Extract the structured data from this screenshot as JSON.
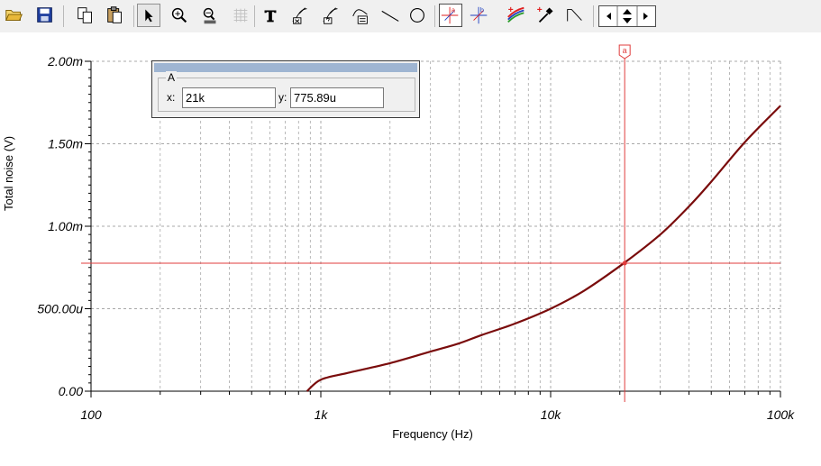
{
  "toolbar": {
    "tools": [
      {
        "icon": "open-folder-icon"
      },
      {
        "icon": "save-disk-icon"
      },
      {
        "icon": "copy-icon"
      },
      {
        "icon": "paste-icon"
      },
      {
        "icon": "pointer-arrow-icon",
        "state": "pressed"
      },
      {
        "icon": "zoom-in-icon"
      },
      {
        "icon": "zoom-100-icon"
      },
      {
        "icon": "grid-icon"
      },
      {
        "icon": "text-tool-icon"
      },
      {
        "icon": "curve-label-x-icon"
      },
      {
        "icon": "curve-label-question-icon"
      },
      {
        "icon": "curve-table-icon"
      },
      {
        "icon": "line-tool-icon"
      },
      {
        "icon": "ellipse-tool-icon"
      },
      {
        "icon": "cursor-a-icon",
        "state": "boxed"
      },
      {
        "icon": "cursor-b-icon"
      },
      {
        "icon": "add-curve-icon"
      },
      {
        "icon": "color-picker-icon"
      },
      {
        "icon": "step-line-icon"
      }
    ],
    "spinner": [
      "left-arrow-icon",
      "up-down-arrow-icon",
      "right-arrow-icon"
    ]
  },
  "cursor_window": {
    "group_label": "A",
    "x_label": "x:",
    "x_value": "21k",
    "y_label": "y:",
    "y_value": "775.89u",
    "marker_label": "a"
  },
  "colors": {
    "curve": "#7a0c0c",
    "cursor": "#e03c3c",
    "grid": "#a8a8a8",
    "axis": "#000000",
    "background": "#ffffff"
  },
  "chart_data": {
    "type": "line",
    "title": "",
    "xlabel": "Frequency (Hz)",
    "ylabel": "Total noise (V)",
    "x_scale": "log",
    "xlim": [
      100,
      100000
    ],
    "ylim": [
      0,
      0.002
    ],
    "x_ticks": [
      {
        "value": 100,
        "label": "100"
      },
      {
        "value": 1000,
        "label": "1k"
      },
      {
        "value": 10000,
        "label": "10k"
      },
      {
        "value": 100000,
        "label": "100k"
      }
    ],
    "y_ticks": [
      {
        "value": 0,
        "label": "0.00"
      },
      {
        "value": 0.0005,
        "label": "500.00u"
      },
      {
        "value": 0.001,
        "label": "1.00m"
      },
      {
        "value": 0.0015,
        "label": "1.50m"
      },
      {
        "value": 0.002,
        "label": "2.00m"
      }
    ],
    "grid": true,
    "series": [
      {
        "points": [
          [
            870,
            0
          ],
          [
            1000,
            7e-05
          ],
          [
            1300,
            0.00011
          ],
          [
            2000,
            0.00017
          ],
          [
            3000,
            0.00024
          ],
          [
            4000,
            0.00029
          ],
          [
            5000,
            0.00034
          ],
          [
            7000,
            0.00041
          ],
          [
            10000,
            0.0005
          ],
          [
            14000,
            0.00061
          ],
          [
            21000,
            0.00078
          ],
          [
            30000,
            0.00095
          ],
          [
            40000,
            0.00112
          ],
          [
            50000,
            0.00127
          ],
          [
            70000,
            0.00151
          ],
          [
            100000,
            0.00173
          ]
        ]
      }
    ],
    "cursor": {
      "x": 21000,
      "y": 0.00077589
    }
  }
}
